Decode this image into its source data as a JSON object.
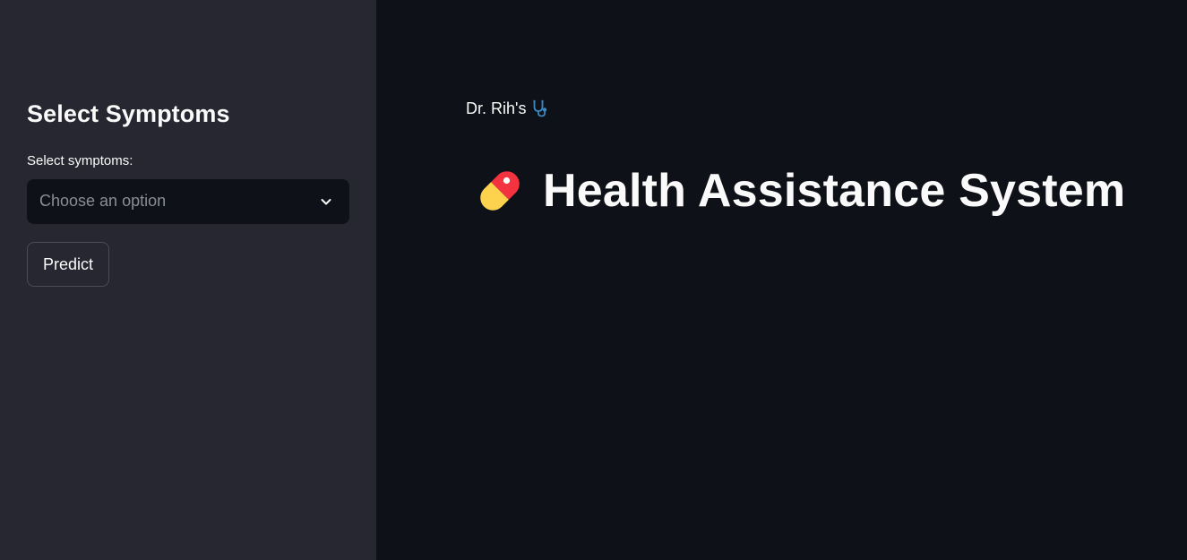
{
  "sidebar": {
    "title": "Select Symptoms",
    "symptoms_select": {
      "label": "Select symptoms:",
      "placeholder": "Choose an option",
      "icon": "chevron-down-icon"
    },
    "predict_label": "Predict"
  },
  "main": {
    "subheader": "Dr. Rih's",
    "subheader_icon": "stethoscope-icon",
    "title": "Health Assistance System",
    "title_icon": "pill-icon"
  },
  "colors": {
    "main_background": "#0e1117",
    "sidebar_background": "#262730",
    "text": "#fafafa",
    "placeholder": "#8a8d97",
    "pill_red": "#f3333f",
    "pill_yellow": "#fdd34d",
    "stethoscope_blue": "#3b88c3"
  }
}
